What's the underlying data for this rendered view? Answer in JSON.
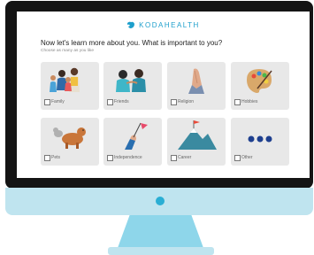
{
  "brand": {
    "name": "KODAHEALTH",
    "color": "#1d9fcc"
  },
  "page": {
    "heading": "Now let's learn more about you. What is important to you?",
    "subheading": "Choose as many as you like"
  },
  "options": [
    {
      "label": "Family",
      "icon": "family-icon",
      "checked": false
    },
    {
      "label": "Friends",
      "icon": "friends-icon",
      "checked": false
    },
    {
      "label": "Religion",
      "icon": "praying-hands-icon",
      "checked": false
    },
    {
      "label": "Hobbies",
      "icon": "paint-palette-icon",
      "checked": false
    },
    {
      "label": "Pets",
      "icon": "pets-icon",
      "checked": false
    },
    {
      "label": "Independence",
      "icon": "hand-flag-icon",
      "checked": false
    },
    {
      "label": "Career",
      "icon": "mountain-flag-icon",
      "checked": false
    },
    {
      "label": "Other",
      "icon": "more-dots-icon",
      "checked": false
    }
  ],
  "colors": {
    "card": "#e8e8e8",
    "accent": "#1d9fcc",
    "dots": "#1e3f8f",
    "monitor": "#141414",
    "chin": "#bfe4ef"
  }
}
